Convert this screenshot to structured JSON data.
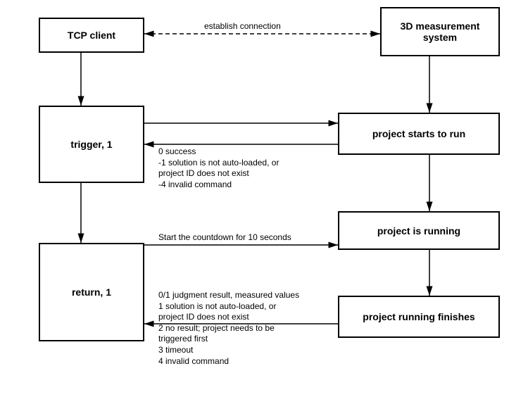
{
  "boxes": {
    "tcp_client": "TCP client",
    "system_3d": "3D measurement system",
    "trigger": "trigger, 1",
    "project_starts": "project starts to run",
    "project_running": "project is running",
    "return": "return, 1",
    "project_finishes": "project running finishes"
  },
  "labels": {
    "establish": "establish connection",
    "trigger_resp_l1": "0 success",
    "trigger_resp_l2": "-1 solution is not auto-loaded, or",
    "trigger_resp_l3": "project ID does not exist",
    "trigger_resp_l4": "-4 invalid command",
    "countdown": "Start the countdown for 10 seconds",
    "return_resp_l1": "0/1 judgment result, measured values",
    "return_resp_l2": "1 solution is not auto-loaded, or",
    "return_resp_l3": "project ID does not exist",
    "return_resp_l4": "2 no result; project needs to be",
    "return_resp_l5": "triggered first",
    "return_resp_l6": "3 timeout",
    "return_resp_l7": "4 invalid command"
  },
  "chart_data": {
    "type": "flowchart",
    "nodes": [
      {
        "id": "tcp_client",
        "label": "TCP client"
      },
      {
        "id": "system_3d",
        "label": "3D measurement system"
      },
      {
        "id": "trigger",
        "label": "trigger, 1"
      },
      {
        "id": "project_starts",
        "label": "project starts to run"
      },
      {
        "id": "project_running",
        "label": "project is running"
      },
      {
        "id": "return",
        "label": "return, 1"
      },
      {
        "id": "project_finishes",
        "label": "project running finishes"
      }
    ],
    "edges": [
      {
        "from": "tcp_client",
        "to": "system_3d",
        "style": "dashed-bidirectional",
        "label": "establish connection"
      },
      {
        "from": "tcp_client",
        "to": "trigger",
        "style": "solid"
      },
      {
        "from": "system_3d",
        "to": "project_starts",
        "style": "solid"
      },
      {
        "from": "trigger",
        "to": "project_starts",
        "style": "solid"
      },
      {
        "from": "project_starts",
        "to": "trigger",
        "style": "solid",
        "label": "0 success; -1 solution is not auto-loaded, or project ID does not exist; -4 invalid command"
      },
      {
        "from": "trigger",
        "to": "return",
        "style": "solid"
      },
      {
        "from": "project_starts",
        "to": "project_running",
        "style": "solid"
      },
      {
        "from": "return",
        "to": "project_running",
        "style": "solid",
        "label": "Start the countdown for 10 seconds"
      },
      {
        "from": "project_running",
        "to": "project_finishes",
        "style": "solid"
      },
      {
        "from": "project_finishes",
        "to": "return",
        "style": "solid",
        "label": "0/1 judgment result, measured values; 1 solution is not auto-loaded, or project ID does not exist; 2 no result; project needs to be triggered first; 3 timeout; 4 invalid command"
      }
    ]
  }
}
